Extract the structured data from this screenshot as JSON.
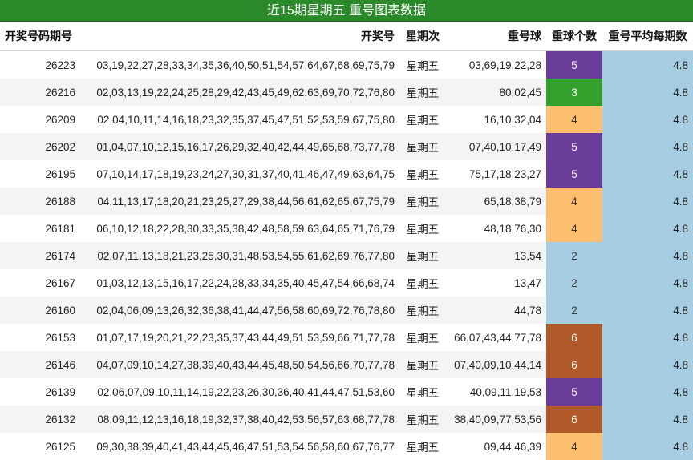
{
  "title": "近15期星期五 重号图表数据",
  "headers": {
    "period": "开奖号码期号",
    "numbers": "开奖号",
    "weekday": "星期次",
    "repeat_balls": "重号球",
    "repeat_count": "重球个数",
    "avg": "重号平均每期数"
  },
  "count_colors": {
    "2": "#a6cde2",
    "3": "#33a02c",
    "4": "#fdbf6f",
    "5": "#6a3d9a",
    "6": "#b15928"
  },
  "rows": [
    {
      "period": "26223",
      "numbers": "03,19,22,27,28,33,34,35,36,40,50,51,54,57,64,67,68,69,75,79",
      "weekday": "星期五",
      "repeat_balls": "03,69,19,22,28",
      "repeat_count": "5",
      "avg": "4.8"
    },
    {
      "period": "26216",
      "numbers": "02,03,13,19,22,24,25,28,29,42,43,45,49,62,63,69,70,72,76,80",
      "weekday": "星期五",
      "repeat_balls": "80,02,45",
      "repeat_count": "3",
      "avg": "4.8"
    },
    {
      "period": "26209",
      "numbers": "02,04,10,11,14,16,18,23,32,35,37,45,47,51,52,53,59,67,75,80",
      "weekday": "星期五",
      "repeat_balls": "16,10,32,04",
      "repeat_count": "4",
      "avg": "4.8"
    },
    {
      "period": "26202",
      "numbers": "01,04,07,10,12,15,16,17,26,29,32,40,42,44,49,65,68,73,77,78",
      "weekday": "星期五",
      "repeat_balls": "07,40,10,17,49",
      "repeat_count": "5",
      "avg": "4.8"
    },
    {
      "period": "26195",
      "numbers": "07,10,14,17,18,19,23,24,27,30,31,37,40,41,46,47,49,63,64,75",
      "weekday": "星期五",
      "repeat_balls": "75,17,18,23,27",
      "repeat_count": "5",
      "avg": "4.8"
    },
    {
      "period": "26188",
      "numbers": "04,11,13,17,18,20,21,23,25,27,29,38,44,56,61,62,65,67,75,79",
      "weekday": "星期五",
      "repeat_balls": "65,18,38,79",
      "repeat_count": "4",
      "avg": "4.8"
    },
    {
      "period": "26181",
      "numbers": "06,10,12,18,22,28,30,33,35,38,42,48,58,59,63,64,65,71,76,79",
      "weekday": "星期五",
      "repeat_balls": "48,18,76,30",
      "repeat_count": "4",
      "avg": "4.8"
    },
    {
      "period": "26174",
      "numbers": "02,07,11,13,18,21,23,25,30,31,48,53,54,55,61,62,69,76,77,80",
      "weekday": "星期五",
      "repeat_balls": "13,54",
      "repeat_count": "2",
      "avg": "4.8"
    },
    {
      "period": "26167",
      "numbers": "01,03,12,13,15,16,17,22,24,28,33,34,35,40,45,47,54,66,68,74",
      "weekday": "星期五",
      "repeat_balls": "13,47",
      "repeat_count": "2",
      "avg": "4.8"
    },
    {
      "period": "26160",
      "numbers": "02,04,06,09,13,26,32,36,38,41,44,47,56,58,60,69,72,76,78,80",
      "weekday": "星期五",
      "repeat_balls": "44,78",
      "repeat_count": "2",
      "avg": "4.8"
    },
    {
      "period": "26153",
      "numbers": "01,07,17,19,20,21,22,23,35,37,43,44,49,51,53,59,66,71,77,78",
      "weekday": "星期五",
      "repeat_balls": "66,07,43,44,77,78",
      "repeat_count": "6",
      "avg": "4.8"
    },
    {
      "period": "26146",
      "numbers": "04,07,09,10,14,27,38,39,40,43,44,45,48,50,54,56,66,70,77,78",
      "weekday": "星期五",
      "repeat_balls": "07,40,09,10,44,14",
      "repeat_count": "6",
      "avg": "4.8"
    },
    {
      "period": "26139",
      "numbers": "02,06,07,09,10,11,14,19,22,23,26,30,36,40,41,44,47,51,53,60",
      "weekday": "星期五",
      "repeat_balls": "40,09,11,19,53",
      "repeat_count": "5",
      "avg": "4.8"
    },
    {
      "period": "26132",
      "numbers": "08,09,11,12,13,16,18,19,32,37,38,40,42,53,56,57,63,68,77,78",
      "weekday": "星期五",
      "repeat_balls": "38,40,09,77,53,56",
      "repeat_count": "6",
      "avg": "4.8"
    },
    {
      "period": "26125",
      "numbers": "09,30,38,39,40,41,43,44,45,46,47,51,53,54,56,58,60,67,76,77",
      "weekday": "星期五",
      "repeat_balls": "09,44,46,39",
      "repeat_count": "4",
      "avg": "4.8"
    }
  ]
}
